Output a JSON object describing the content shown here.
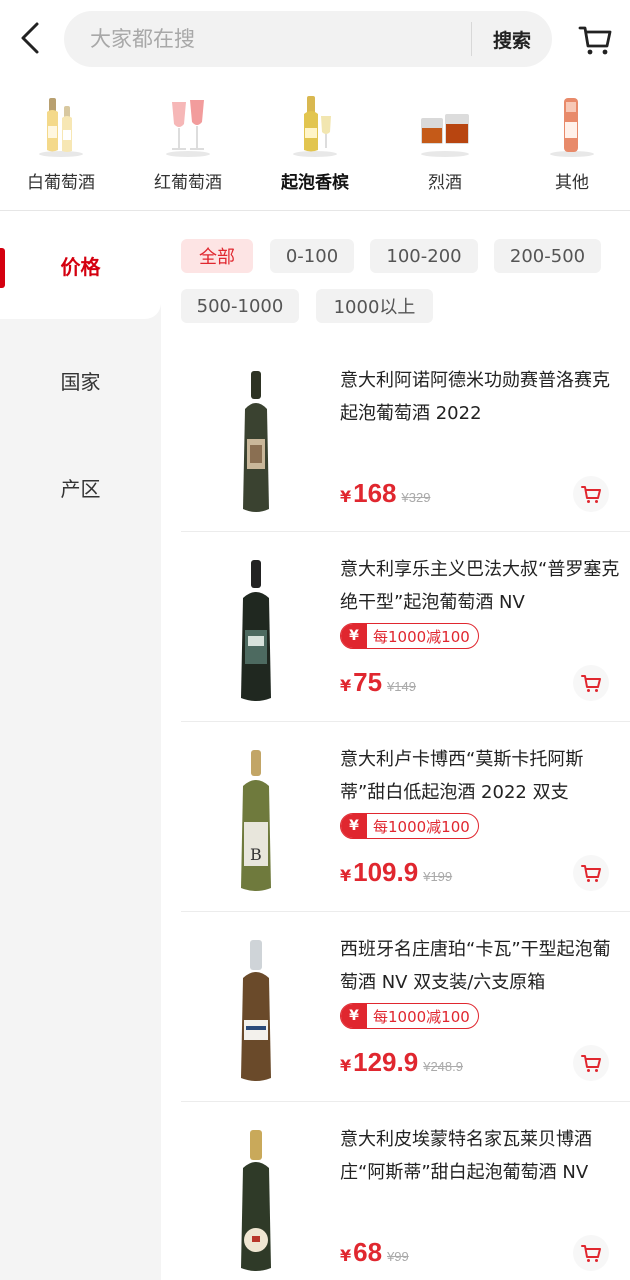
{
  "header": {
    "search_placeholder": "大家都在搜",
    "search_button": "搜索",
    "icons": {
      "back": "chevron-left-icon",
      "cart": "cart-icon"
    }
  },
  "categories": [
    {
      "label": "白葡萄酒",
      "active": false
    },
    {
      "label": "红葡萄酒",
      "active": false
    },
    {
      "label": "起泡香槟",
      "active": true
    },
    {
      "label": "烈酒",
      "active": false
    },
    {
      "label": "其他",
      "active": false
    }
  ],
  "sidebar": {
    "items": [
      {
        "label": "价格",
        "active": true
      },
      {
        "label": "国家",
        "active": false
      },
      {
        "label": "产区",
        "active": false
      }
    ]
  },
  "price_filters": [
    {
      "label": "全部",
      "active": true
    },
    {
      "label": "0-100",
      "active": false
    },
    {
      "label": "100-200",
      "active": false
    },
    {
      "label": "200-500",
      "active": false
    },
    {
      "label": "500-1000",
      "active": false
    },
    {
      "label": "1000以上",
      "active": false
    }
  ],
  "products": [
    {
      "title": "意大利阿诺阿德米功勋赛普洛赛克起泡葡萄酒 2022",
      "coupon": null,
      "currency": "¥",
      "price": "168",
      "original_price": "¥329"
    },
    {
      "title": "意大利享乐主义巴法大叔“普罗塞克绝干型”起泡葡萄酒 NV",
      "coupon": {
        "icon": "¥",
        "text": "每1000减100"
      },
      "currency": "¥",
      "price": "75",
      "original_price": "¥149"
    },
    {
      "title": "意大利卢卡博西“莫斯卡托阿斯蒂”甜白低起泡酒 2022 双支",
      "coupon": {
        "icon": "¥",
        "text": "每1000减100"
      },
      "currency": "¥",
      "price": "109.9",
      "original_price": "¥199"
    },
    {
      "title": "西班牙名庄唐珀“卡瓦”干型起泡葡萄酒 NV 双支装/六支原箱",
      "coupon": {
        "icon": "¥",
        "text": "每1000减100"
      },
      "currency": "¥",
      "price": "129.9",
      "original_price": "¥248.9"
    },
    {
      "title": "意大利皮埃蒙特名家瓦莱贝博酒庄“阿斯蒂”甜白起泡葡萄酒 NV",
      "coupon": null,
      "currency": "¥",
      "price": "68",
      "original_price": "¥99"
    }
  ],
  "colors": {
    "accent": "#e0272f",
    "sidebar_bg": "#f4f4f4",
    "chip_bg": "#f2f2f2",
    "chip_active_bg": "#fde4e4"
  }
}
